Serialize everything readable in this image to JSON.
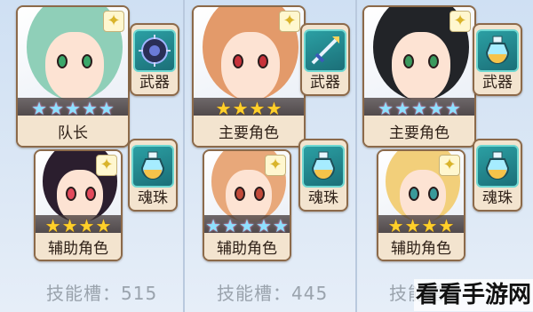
{
  "columns": [
    {
      "main": {
        "role": "队长",
        "stars": 5,
        "star_style": "rainbow",
        "hair": "#8fcfb8",
        "eyes": "#3aa86a"
      },
      "weapon_slot": {
        "label": "武器",
        "icon": "spiked-orb-icon"
      },
      "support": {
        "role": "辅助角色",
        "stars": 4,
        "star_style": "gold",
        "hair": "#2b1e2e",
        "eyes": "#e24a5c"
      },
      "soul_slot": {
        "label": "魂珠",
        "icon": "potion-icon"
      },
      "skill_text": "技能槽：515"
    },
    {
      "main": {
        "role": "主要角色",
        "stars": 4,
        "star_style": "gold",
        "hair": "#e39a6a",
        "eyes": "#c8323a"
      },
      "weapon_slot": {
        "label": "武器",
        "icon": "sword-icon"
      },
      "support": {
        "role": "辅助角色",
        "stars": 5,
        "star_style": "rainbow",
        "hair": "#e8a87a",
        "eyes": "#c24a3a"
      },
      "soul_slot": {
        "label": "魂珠",
        "icon": "potion-icon"
      },
      "skill_text": "技能槽：445"
    },
    {
      "main": {
        "role": "主要角色",
        "stars": 5,
        "star_style": "rainbow",
        "hair": "#222428",
        "eyes": "#3a9a5e"
      },
      "weapon_slot": {
        "label": "武器",
        "icon": "potion-icon"
      },
      "support": {
        "role": "辅助角色",
        "stars": 4,
        "star_style": "gold",
        "hair": "#f2cf7a",
        "eyes": "#3a9a9a"
      },
      "soul_slot": {
        "label": "魂珠",
        "icon": "potion-icon"
      },
      "skill_text": "技能槽"
    }
  ],
  "watermark": "看看手游网",
  "colors": {
    "card_bg": "#f3e4cf",
    "card_border": "#8c6a4a",
    "slot_teal": "#2b9fa3",
    "star_gold": "#ffd02a"
  }
}
